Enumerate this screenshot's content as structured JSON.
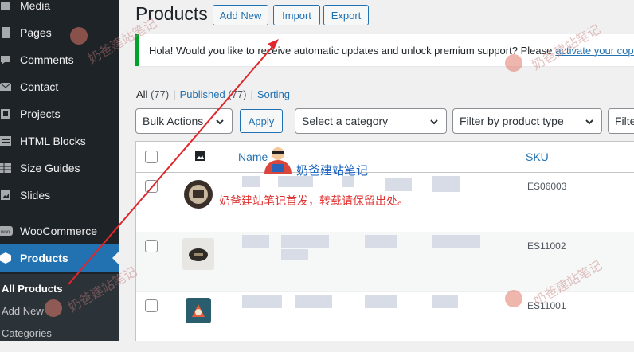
{
  "sidebar": {
    "items": [
      {
        "label": "Media",
        "icon": "media-icon"
      },
      {
        "label": "Pages",
        "icon": "pages-icon"
      },
      {
        "label": "Comments",
        "icon": "comments-icon"
      },
      {
        "label": "Contact",
        "icon": "mail-icon"
      },
      {
        "label": "Projects",
        "icon": "projects-icon"
      },
      {
        "label": "HTML Blocks",
        "icon": "html-blocks-icon"
      },
      {
        "label": "Size Guides",
        "icon": "size-guides-icon"
      },
      {
        "label": "Slides",
        "icon": "slides-icon"
      },
      {
        "label": "WooCommerce",
        "icon": "woocommerce-icon"
      },
      {
        "label": "Products",
        "icon": "products-icon"
      }
    ],
    "submenu": [
      "All Products",
      "Add New",
      "Categories"
    ]
  },
  "header": {
    "title": "Products",
    "add_new": "Add New",
    "import": "Import",
    "export": "Export"
  },
  "notice": {
    "text": "Hola! Would you like to receive automatic updates and unlock premium support? Please",
    "link": "activate your copy"
  },
  "views": {
    "all": "All",
    "all_count": "(77)",
    "published": "Published",
    "published_count": "(77)",
    "sorting": "Sorting"
  },
  "filters": {
    "bulk_actions": "Bulk Actions",
    "apply": "Apply",
    "category": "Select a category",
    "product_type": "Filter by product type",
    "stock": "Filte"
  },
  "table": {
    "columns": {
      "name": "Name",
      "sku": "SKU"
    },
    "rows": [
      {
        "sku": "ES06003"
      },
      {
        "sku": "ES11002"
      },
      {
        "sku": "ES11001"
      }
    ]
  },
  "overlay": {
    "watermark": "奶爸建站笔记",
    "caption": "奶爸建站笔记首发，转载请保留出处。"
  },
  "colors": {
    "sidebar": "#1d2327",
    "accent": "#2271b1",
    "notice_border": "#00a32a",
    "annotation_arrow": "#e0262b"
  }
}
